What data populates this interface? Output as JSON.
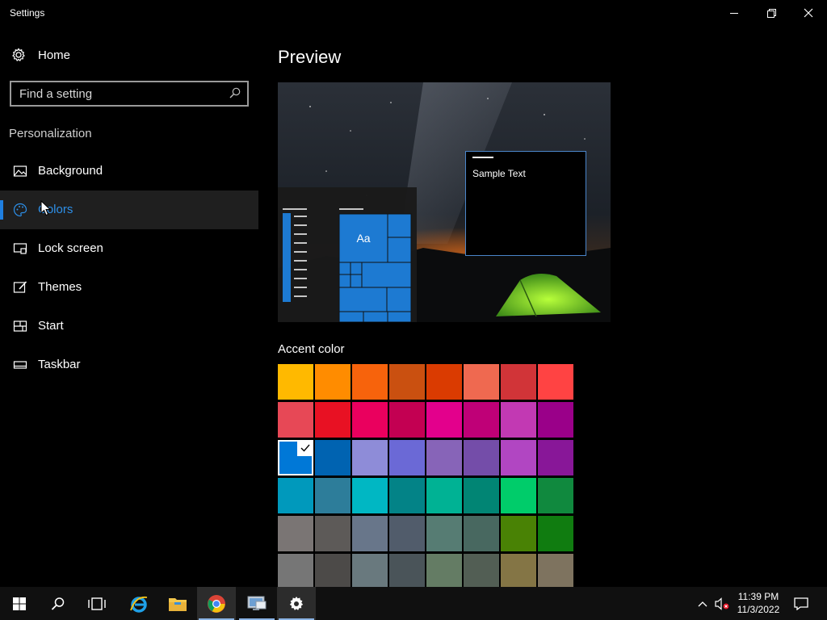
{
  "window": {
    "title": "Settings"
  },
  "sidebar": {
    "home_label": "Home",
    "search_placeholder": "Find a setting",
    "section_label": "Personalization",
    "items": [
      {
        "label": "Background",
        "icon": "picture-icon",
        "selected": false
      },
      {
        "label": "Colors",
        "icon": "palette-icon",
        "selected": true
      },
      {
        "label": "Lock screen",
        "icon": "lock-screen-icon",
        "selected": false
      },
      {
        "label": "Themes",
        "icon": "brush-icon",
        "selected": false
      },
      {
        "label": "Start",
        "icon": "start-menu-icon",
        "selected": false
      },
      {
        "label": "Taskbar",
        "icon": "taskbar-icon",
        "selected": false
      }
    ]
  },
  "main": {
    "preview_title": "Preview",
    "preview_sample_text": "Sample Text",
    "preview_tile_text": "Aa",
    "accent_label": "Accent color",
    "selected_accent": "#0078d7",
    "accent_colors": [
      [
        "#ffb900",
        "#ff8c00",
        "#f7630c",
        "#ca5010",
        "#da3b01",
        "#ef6950",
        "#d13438",
        "#ff4343"
      ],
      [
        "#e74856",
        "#e81123",
        "#ea005e",
        "#c30052",
        "#e3008c",
        "#bf0077",
        "#c239b3",
        "#9a0089"
      ],
      [
        "#0078d7",
        "#0063b1",
        "#8e8cd8",
        "#6b69d6",
        "#8764b8",
        "#744da9",
        "#b146c2",
        "#881798"
      ],
      [
        "#0099bc",
        "#2d7d9a",
        "#00b7c3",
        "#038387",
        "#00b294",
        "#018574",
        "#00cc6a",
        "#10893e"
      ],
      [
        "#7a7574",
        "#5d5a58",
        "#68768a",
        "#515c6b",
        "#567c73",
        "#486860",
        "#498205",
        "#107c10"
      ],
      [
        "#767676",
        "#4c4a48",
        "#69797e",
        "#4a5459",
        "#647c64",
        "#525e54",
        "#847545",
        "#7e735f"
      ]
    ]
  },
  "taskbar": {
    "time": "11:39 PM",
    "date": "11/3/2022",
    "apps": [
      "start-icon",
      "search-icon",
      "task-view-icon",
      "internet-explorer-icon",
      "file-explorer-icon",
      "chrome-icon",
      "remote-desktop-icon",
      "settings-icon"
    ]
  }
}
